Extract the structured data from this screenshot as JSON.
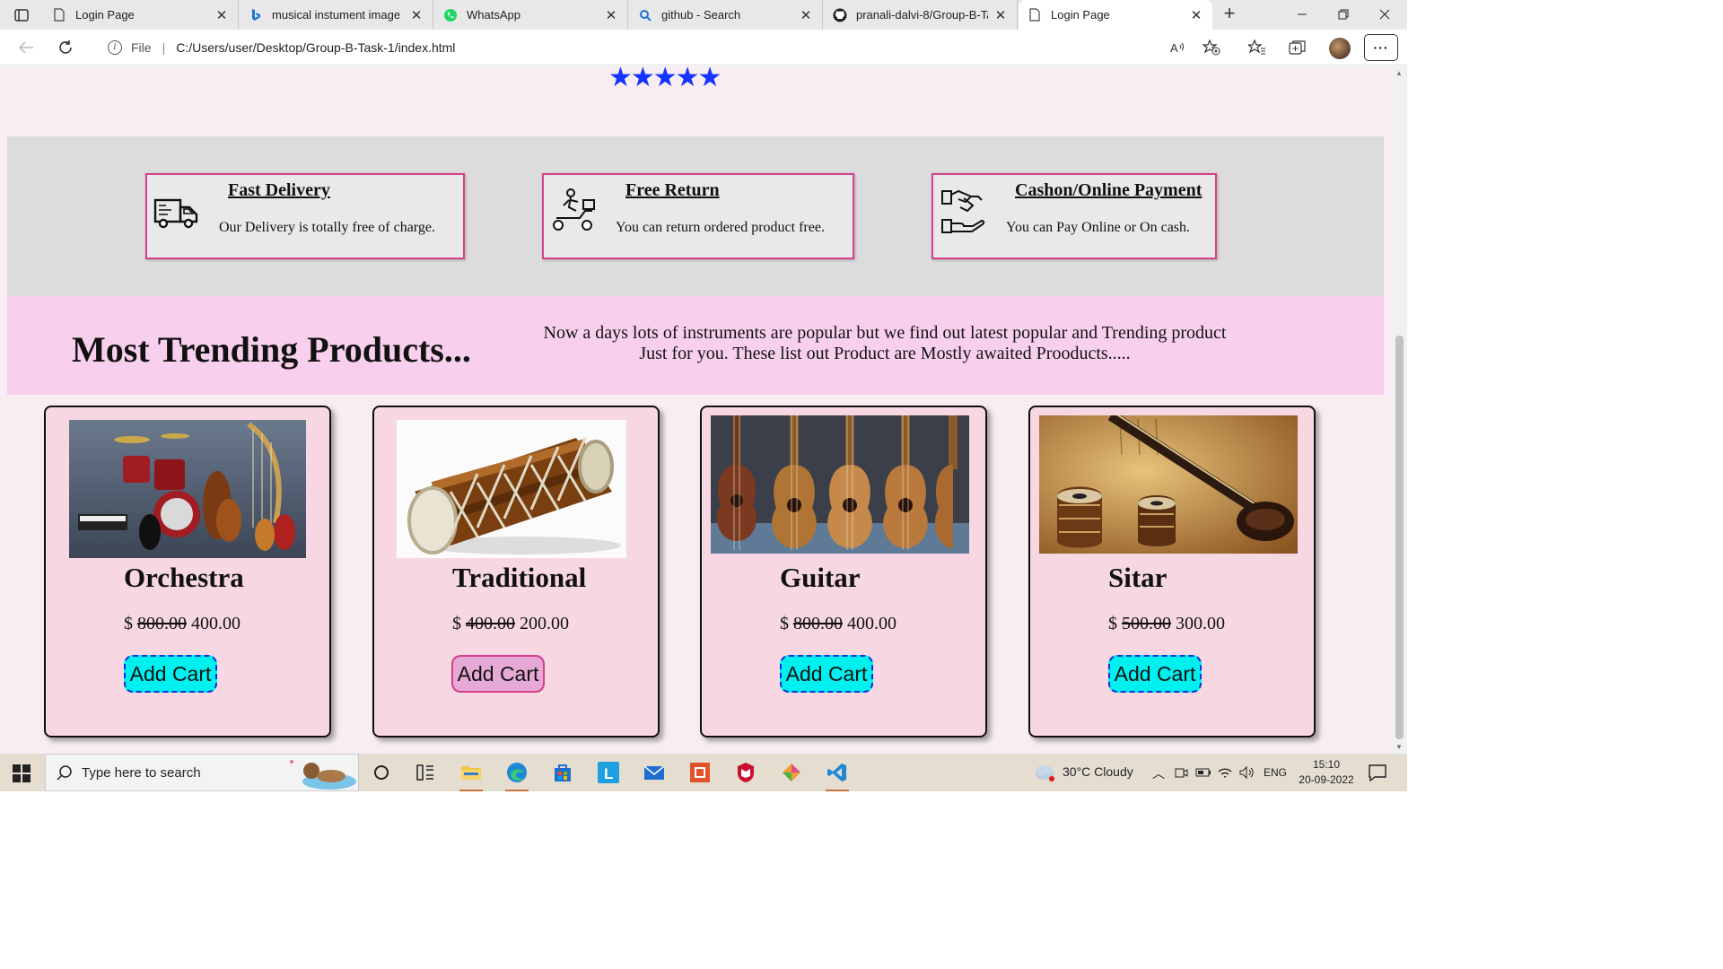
{
  "browser": {
    "tabs": [
      {
        "label": "Login Page",
        "icon": "page-icon"
      },
      {
        "label": "musical instument image - B",
        "icon": "bing-icon"
      },
      {
        "label": "WhatsApp",
        "icon": "whatsapp-icon"
      },
      {
        "label": "github - Search",
        "icon": "search-icon"
      },
      {
        "label": "pranali-dalvi-8/Group-B-Ta",
        "icon": "github-icon"
      },
      {
        "label": "Login Page",
        "icon": "page-icon",
        "active": true
      }
    ],
    "address": {
      "scheme_label": "File",
      "url": "C:/Users/user/Desktop/Group-B-Task-1/index.html"
    }
  },
  "page": {
    "rating_stars": "★★★★★",
    "features": [
      {
        "title": "Fast Delivery",
        "text": "Our Delivery is totally free of charge.",
        "icon": "delivery-truck-icon"
      },
      {
        "title": "Free Return",
        "text": "You can return ordered product free.",
        "icon": "scooter-rider-icon"
      },
      {
        "title": "Cashon/Online Payment",
        "text": "You can Pay Online or On cash.",
        "icon": "payment-hands-icon"
      }
    ],
    "trending": {
      "heading": "Most Trending Products...",
      "description_line1": "Now a days lots of instruments are popular but we find out latest popular and Trending product",
      "description_line2": "Just for you. These list out Product are Mostly awaited Prooducts....."
    },
    "products": [
      {
        "name": "Orchestra",
        "currency": "$",
        "old_price": "800.00",
        "new_price": "400.00",
        "button": "Add Cart",
        "image": "orchestra-instruments-image"
      },
      {
        "name": "Traditional",
        "currency": "$",
        "old_price": "400.00",
        "new_price": "200.00",
        "button": "Add Cart",
        "image": "dholak-drum-image"
      },
      {
        "name": "Guitar",
        "currency": "$",
        "old_price": "800.00",
        "new_price": "400.00",
        "button": "Add Cart",
        "image": "ukulele-row-image"
      },
      {
        "name": "Sitar",
        "currency": "$",
        "old_price": "500.00",
        "new_price": "300.00",
        "button": "Add Cart",
        "image": "sitar-tabla-image"
      }
    ],
    "colors": {
      "star": "#1434ff",
      "feature_border": "#d53f8c",
      "trend_band": "#f8d0ee",
      "button_cyan": "#00f0f0",
      "button_pink": "#e6a8d4"
    }
  },
  "taskbar": {
    "search_placeholder": "Type here to search",
    "weather": "30°C  Cloudy",
    "language": "ENG",
    "time": "15:10",
    "date": "20-09-2022"
  }
}
